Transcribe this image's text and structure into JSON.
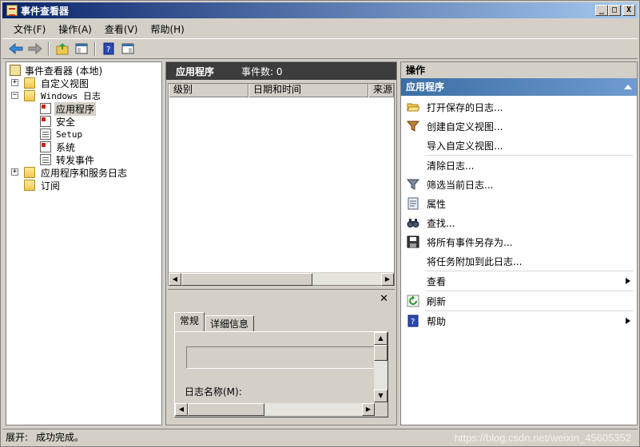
{
  "window": {
    "title": "事件查看器",
    "buttons": {
      "min": "_",
      "max": "□",
      "close": "X"
    }
  },
  "menu": [
    "文件(F)",
    "操作(A)",
    "查看(V)",
    "帮助(H)"
  ],
  "tree": {
    "root": "事件查看器 (本地)",
    "custom_views": "自定义视图",
    "windows_logs": "Windows 日志",
    "logs": [
      "应用程序",
      "安全",
      "Setup",
      "系统",
      "转发事件"
    ],
    "app_service_logs": "应用程序和服务日志",
    "subscriptions": "订阅"
  },
  "center": {
    "title": "应用程序",
    "event_count": "事件数: 0",
    "columns": [
      "级别",
      "日期和时间",
      "来源"
    ],
    "close_symbol": "✕",
    "tabs": [
      "常规",
      "详细信息"
    ],
    "log_name_label": "日志名称(M):"
  },
  "actions": {
    "header": "操作",
    "section": "应用程序",
    "items": [
      {
        "label": "打开保存的日志...",
        "icon": "folder-open-icon"
      },
      {
        "label": "创建自定义视图...",
        "icon": "filter-icon"
      },
      {
        "label": "导入自定义视图...",
        "icon": ""
      },
      {
        "label": "清除日志...",
        "icon": ""
      },
      {
        "label": "筛选当前日志...",
        "icon": "filter-icon"
      },
      {
        "label": "属性",
        "icon": "properties-icon"
      },
      {
        "label": "查找...",
        "icon": "binoculars-icon"
      },
      {
        "label": "将所有事件另存为...",
        "icon": "save-icon"
      },
      {
        "label": "将任务附加到此日志...",
        "icon": ""
      },
      {
        "label": "查看",
        "icon": ""
      },
      {
        "label": "刷新",
        "icon": "refresh-icon"
      },
      {
        "label": "帮助",
        "icon": "help-icon"
      }
    ]
  },
  "status": {
    "left": "展开:",
    "text": "成功完成。",
    "watermark": "https://blog.csdn.net/weixin_45605352"
  },
  "colors": {
    "title_gradient_start": "#0a246a",
    "actions_section": "#3a6ea5",
    "center_header": "#3c3c3c"
  }
}
